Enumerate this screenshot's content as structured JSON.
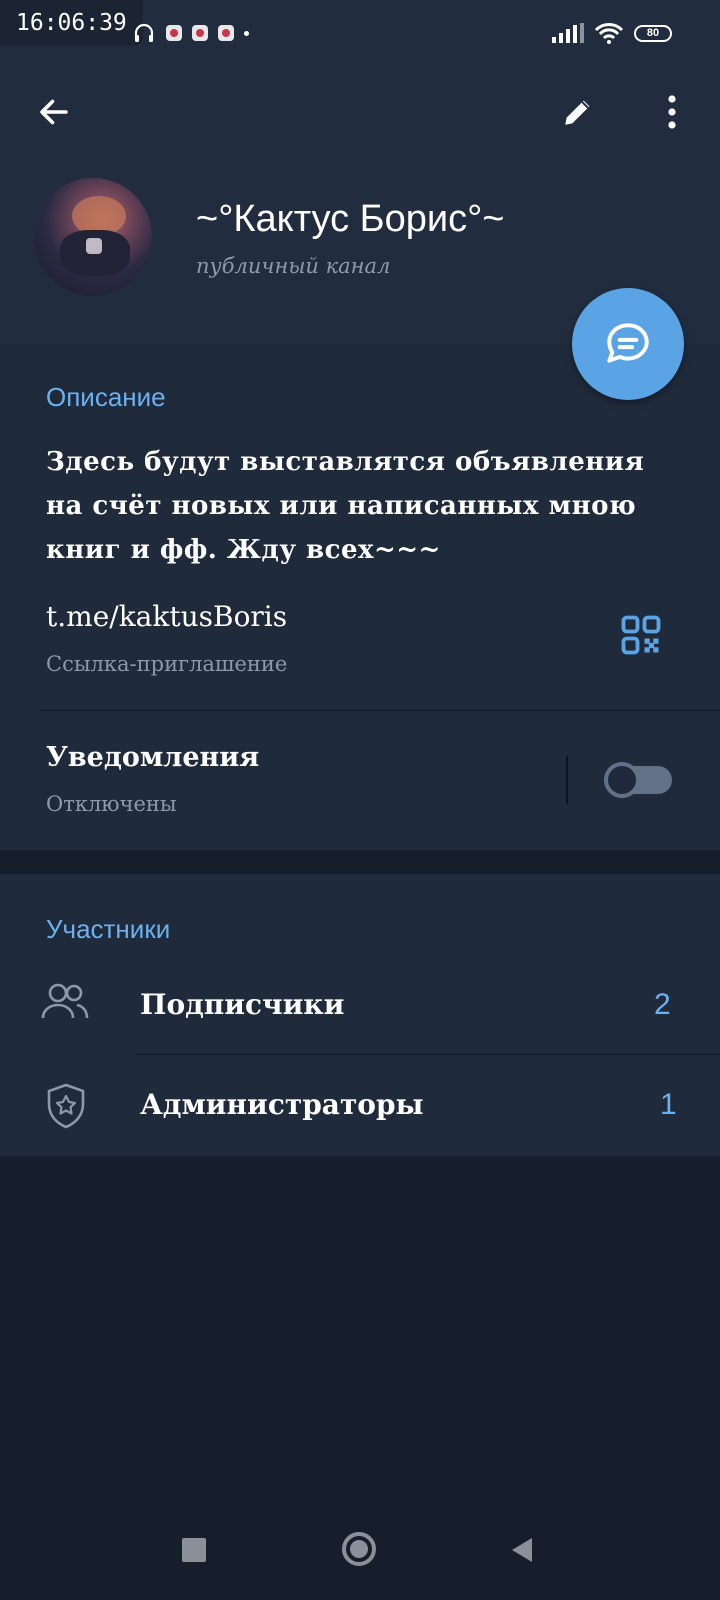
{
  "status_bar": {
    "time": "16:06:39",
    "battery": "80"
  },
  "toolbar": {
    "back_icon": "arrow-left-icon",
    "edit_icon": "pencil-icon",
    "more_icon": "more-vertical-icon"
  },
  "channel": {
    "name": "~°Кактус Борис°~",
    "type": "публичный канал"
  },
  "about": {
    "heading": "Описание",
    "description": "Здесь будут выставлятся объявления на счёт новых или написанных мною книг и фф. Жду всех~~~",
    "link": "t.me/kaktusBoris",
    "link_caption": "Ссылка-приглашение",
    "notifications_label": "Уведомления",
    "notifications_status": "Отключены",
    "notifications_on": false
  },
  "participants": {
    "heading": "Участники",
    "items": [
      {
        "label": "Подписчики",
        "count": "2",
        "icon": "people-icon"
      },
      {
        "label": "Администраторы",
        "count": "1",
        "icon": "shield-star-icon"
      }
    ]
  },
  "colors": {
    "accent": "#5aa3e4",
    "header_bg": "#212d3f",
    "card_bg": "#1f2a3b",
    "page_bg": "#161e2c"
  }
}
